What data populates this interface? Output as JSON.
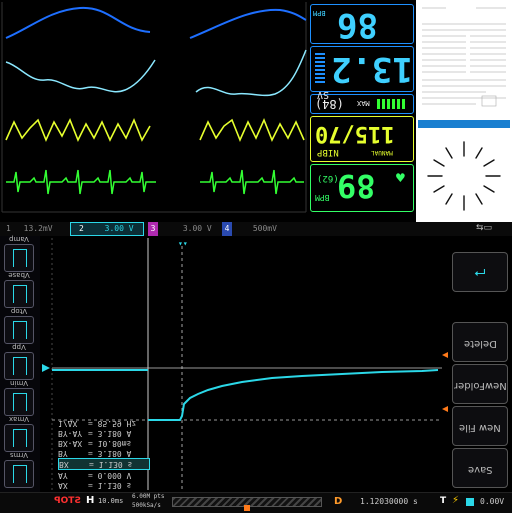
{
  "monitor": {
    "hr_value": "86",
    "hr_unit": "BPM",
    "co_value": "13.2",
    "sv_label": "SV",
    "sv_sub": "(84)",
    "max_label": "MAX",
    "nibp_label": "NIBP",
    "nibp_value": "115/70",
    "nibp_mode": "MANUAL",
    "nibp_sub": "(62)",
    "pulse_value": "89",
    "pulse_unit": "BPM",
    "colors": {
      "hr": "#3fd0ff",
      "co": "#3fd0ff",
      "nibp": "#e6ff2e",
      "pulse": "#33ff66",
      "frame": "#1e90ff"
    }
  },
  "scope": {
    "channels": [
      {
        "label": "1",
        "scale": "13.2mV"
      },
      {
        "label": "2",
        "scale": "3.00 V"
      },
      {
        "label": "3",
        "scale": "3.00 V"
      },
      {
        "label": "4",
        "scale": "500mV"
      }
    ],
    "left_buttons": [
      "Vamp",
      "Vbase",
      "Vtop",
      "Vpp",
      "Vmin",
      "Vmax",
      "Vrms"
    ],
    "right_buttons": [
      "Delete",
      "NewFolder",
      "New File",
      "Save"
    ],
    "measurements": [
      {
        "label": "1/ΔX",
        "value": "= 85.59 Hz"
      },
      {
        "label": "BY-AY",
        "value": "= 3.180 A"
      },
      {
        "label": "BX-AX",
        "value": "= 10.80ms"
      },
      {
        "label": "BY",
        "value": "= 3.180 A"
      },
      {
        "label": "BX",
        "value": "= 1.130 s"
      },
      {
        "label": "AY",
        "value": "= 0.000 V"
      },
      {
        "label": "AX",
        "value": "= 1.130 s"
      }
    ],
    "status": "STOP",
    "timebase_label": "H",
    "timebase": "10.0ms",
    "sample_rate": "500kSa/s",
    "memory": "6.00M pts",
    "delay_label": "D",
    "delay": "1.12030000 s",
    "trigger_level": "0.00V",
    "trigger_icon": "T",
    "lightning_icon": "⚡"
  },
  "document": {
    "lines": [
      "",
      "",
      "",
      "",
      "",
      "",
      ""
    ]
  }
}
